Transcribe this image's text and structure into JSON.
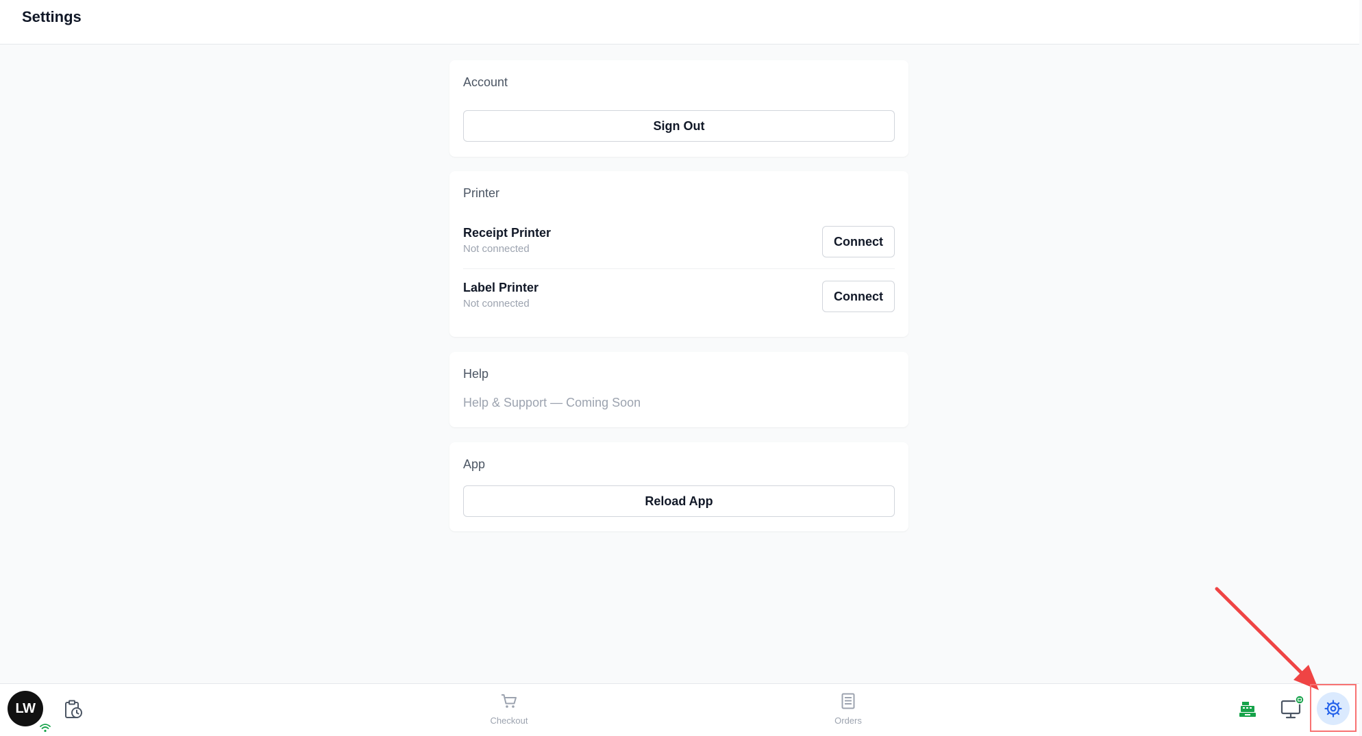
{
  "header": {
    "title": "Settings"
  },
  "account": {
    "title": "Account",
    "sign_out_label": "Sign Out"
  },
  "printer": {
    "title": "Printer",
    "items": [
      {
        "name": "Receipt Printer",
        "status": "Not connected",
        "button_label": "Connect"
      },
      {
        "name": "Label Printer",
        "status": "Not connected",
        "button_label": "Connect"
      }
    ]
  },
  "help": {
    "title": "Help",
    "text": "Help & Support — Coming Soon"
  },
  "app": {
    "title": "App",
    "reload_label": "Reload App"
  },
  "bottom_nav": {
    "avatar_initials": "LW",
    "items": [
      {
        "label": "Checkout",
        "icon": "cart-icon"
      },
      {
        "label": "Orders",
        "icon": "receipt-icon"
      }
    ],
    "right_icons": [
      "cash-register-icon",
      "monitor-icon",
      "gear-icon"
    ],
    "active": "gear-icon"
  },
  "colors": {
    "accent": "#2563eb",
    "active_bg": "#dbeafe",
    "success": "#16a34a",
    "annotation": "#ef4444"
  }
}
